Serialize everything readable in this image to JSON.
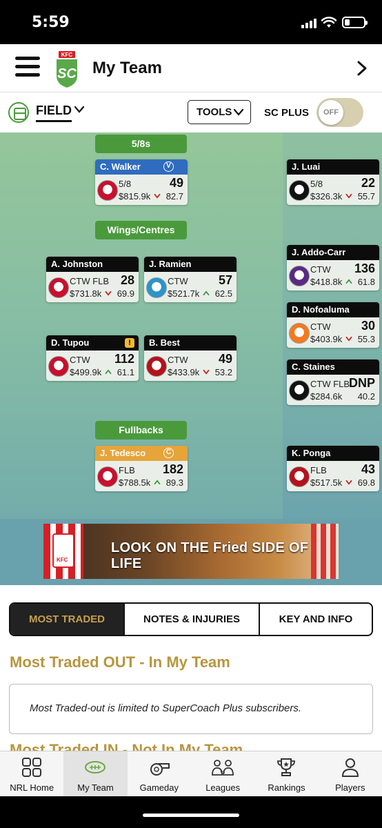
{
  "status_bar": {
    "time": "5:59"
  },
  "header": {
    "title": "My Team"
  },
  "toolbar": {
    "view_label": "FIELD",
    "tools_label": "TOOLS",
    "sc_plus_label": "SC PLUS",
    "toggle_state": "OFF"
  },
  "field": {
    "positions": {
      "halves": "5/8s",
      "wings": "Wings/Centres",
      "fullbacks": "Fullbacks"
    },
    "players": [
      {
        "name": "C. Walker",
        "pos": "5/8",
        "price": "$815.9k",
        "score": "49",
        "avg": "82.7",
        "trend": "down",
        "badge": "V",
        "team_color": "#c8102e"
      },
      {
        "name": "A. Johnston",
        "pos": "CTW FLB",
        "price": "$731.8k",
        "score": "28",
        "avg": "69.9",
        "trend": "down",
        "team_color": "#c8102e"
      },
      {
        "name": "J. Ramien",
        "pos": "CTW",
        "price": "$521.7k",
        "score": "57",
        "avg": "62.5",
        "trend": "up",
        "team_color": "#2b94c9"
      },
      {
        "name": "D. Tupou",
        "pos": "CTW",
        "price": "$499.9k",
        "score": "112",
        "avg": "61.1",
        "trend": "up",
        "badge": "!",
        "team_color": "#c8102e"
      },
      {
        "name": "B. Best",
        "pos": "CTW",
        "price": "$433.9k",
        "score": "49",
        "avg": "53.2",
        "trend": "down",
        "team_color": "#b4121b"
      },
      {
        "name": "J. Tedesco",
        "pos": "FLB",
        "price": "$788.5k",
        "score": "182",
        "avg": "89.3",
        "trend": "up",
        "badge": "C",
        "team_color": "#c8102e"
      }
    ],
    "bench": [
      {
        "name": "J. Luai",
        "pos": "5/8",
        "price": "$326.3k",
        "score": "22",
        "avg": "55.7",
        "trend": "down",
        "team_color": "#111111"
      },
      {
        "name": "J. Addo-Carr",
        "pos": "CTW",
        "price": "$418.8k",
        "score": "136",
        "avg": "61.8",
        "trend": "up",
        "team_color": "#5a2a82"
      },
      {
        "name": "D. Nofoaluma",
        "pos": "CTW",
        "price": "$403.9k",
        "score": "30",
        "avg": "55.3",
        "trend": "down",
        "team_color": "#f47920"
      },
      {
        "name": "C. Staines",
        "pos": "CTW FLB",
        "price": "$284.6k",
        "score": "DNP",
        "avg": "40.2",
        "trend": "none",
        "team_color": "#111111"
      },
      {
        "name": "K. Ponga",
        "pos": "FLB",
        "price": "$517.5k",
        "score": "43",
        "avg": "69.8",
        "trend": "down",
        "team_color": "#b4121b"
      }
    ]
  },
  "ad": {
    "text": "LOOK ON THE Fried SIDE OF LIFE",
    "brand": "KFC"
  },
  "tabs": [
    "MOST TRADED",
    "NOTES & INJURIES",
    "KEY AND INFO"
  ],
  "most_traded": {
    "out_title": "Most Traded OUT - In My Team",
    "notice": "Most Traded-out is limited to SuperCoach Plus subscribers.",
    "in_title": "Most Traded IN - Not In My Team"
  },
  "bottom_nav": [
    {
      "label": "NRL Home",
      "icon": "grid-icon"
    },
    {
      "label": "My Team",
      "icon": "football-icon"
    },
    {
      "label": "Gameday",
      "icon": "whistle-icon"
    },
    {
      "label": "Leagues",
      "icon": "versus-icon"
    },
    {
      "label": "Rankings",
      "icon": "trophy-icon"
    },
    {
      "label": "Players",
      "icon": "player-icon"
    }
  ],
  "colors": {
    "accent_gold": "#b8953e",
    "field_green": "#4a9a3c",
    "up": "#3a9a3a",
    "down": "#cc2222"
  }
}
